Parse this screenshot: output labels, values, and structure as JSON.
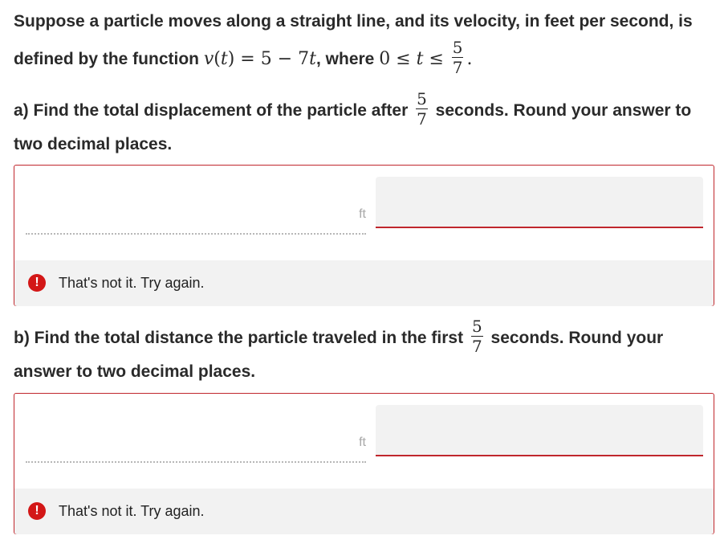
{
  "intro": {
    "text1": "Suppose a particle moves along a straight line, and its velocity, in feet per second, is",
    "text2": "defined by the function",
    "func_lhs": "v",
    "func_var": "t",
    "func_rhs": ") = 5 − 7",
    "func_rhs_var": "t",
    "text3": ", where",
    "domain_expr": "0 ≤ ",
    "domain_var": "t",
    "domain_le": " ≤",
    "frac_num": "5",
    "frac_den": "7",
    "end_punct": "."
  },
  "part_a": {
    "text1": "a) Find the total displacement of the particle after",
    "frac_num": "5",
    "frac_den": "7",
    "text2": "seconds. Round your answer to",
    "text3": "two decimal places.",
    "unit": "ft",
    "input_value": "",
    "feedback": "That's not it. Try again.",
    "feedback_icon": "!"
  },
  "part_b": {
    "text1": "b) Find the total distance the particle traveled in the first",
    "frac_num": "5",
    "frac_den": "7",
    "text2": "seconds. Round your",
    "text3": "answer to two decimal places.",
    "unit": "ft",
    "input_value": "",
    "feedback": "That's not it. Try again.",
    "feedback_icon": "!"
  },
  "colors": {
    "error_red": "#c0272d",
    "feedback_bg": "#f2f2f2",
    "unit_gray": "#a8a8a8"
  }
}
